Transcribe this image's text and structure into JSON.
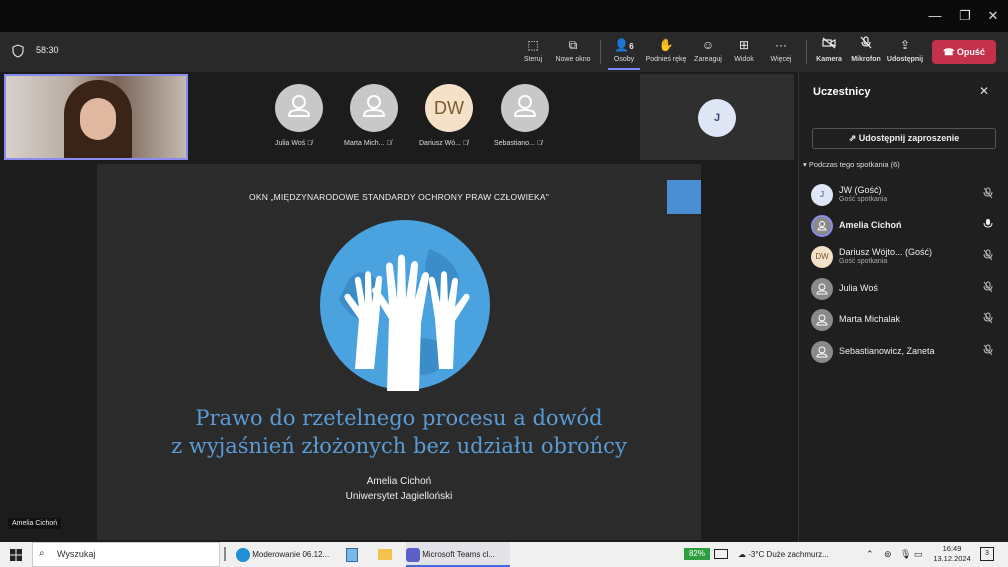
{
  "window": {
    "minimize": "—",
    "maximize": "❐",
    "close": "✕"
  },
  "toolbar": {
    "timer": "58:30",
    "buttons": [
      {
        "label": "Steruj",
        "icon": "control-icon"
      },
      {
        "label": "Nowe okno",
        "icon": "new-window-icon"
      },
      {
        "label": "Osoby",
        "icon": "people-icon",
        "count": "6"
      },
      {
        "label": "Podnieś rękę",
        "icon": "raise-hand-icon"
      },
      {
        "label": "Zareaguj",
        "icon": "react-icon"
      },
      {
        "label": "Widok",
        "icon": "view-icon"
      },
      {
        "label": "Więcej",
        "icon": "more-icon"
      },
      {
        "label": "Kamera",
        "icon": "camera-off-icon"
      },
      {
        "label": "Mikrofon",
        "icon": "mic-off-icon"
      },
      {
        "label": "Udostępnij",
        "icon": "share-icon"
      }
    ],
    "leave": "Opuść"
  },
  "stage": {
    "self_view_name": "Amelia Cichoń",
    "tiles": [
      {
        "name": "Julia Woś",
        "initials": ""
      },
      {
        "name": "Marta Mich...",
        "initials": ""
      },
      {
        "name": "Dariusz Wó...",
        "initials": "DW"
      },
      {
        "name": "Sebastiano...",
        "initials": ""
      }
    ],
    "right_tile_initial": "J",
    "presenter_label": "Amelia Cichoń"
  },
  "slide": {
    "header": "OKN „MIĘDZYNARODOWE STANDARDY OCHRONY PRAW CZŁOWIEKA\"",
    "title_line1": "Prawo do rzetelnego procesu a dowód",
    "title_line2": "z wyjaśnień złożonych bez udziału obrońcy",
    "author": "Amelia Cichoń",
    "affiliation": "Uniwersytet Jagielloński"
  },
  "panel": {
    "title": "Uczestnicy",
    "invite": "Udostępnij zaproszenie",
    "section": "Podczas tego spotkania (6)",
    "participants": [
      {
        "initials": "J",
        "name": "JW (Gość)",
        "sub": "Gość spotkania",
        "mic": "muted"
      },
      {
        "initials": "",
        "name": "Amelia Cichoń",
        "sub": "",
        "mic": "on"
      },
      {
        "initials": "DW",
        "name": "Dariusz Wójto...   (Gość)",
        "sub": "Gość spotkania",
        "mic": "muted"
      },
      {
        "initials": "",
        "name": "Julia Woś",
        "sub": "",
        "mic": "muted"
      },
      {
        "initials": "",
        "name": "Marta Michalak",
        "sub": "",
        "mic": "muted"
      },
      {
        "initials": "",
        "name": "Sebastianowicz, Zaneta",
        "sub": "",
        "mic": "muted"
      }
    ]
  },
  "taskbar": {
    "search_placeholder": "Wyszukaj",
    "apps": [
      {
        "label": "Moderowanie 06.12...",
        "icon": "edge-icon"
      },
      {
        "label": "",
        "icon": "notepad-icon"
      },
      {
        "label": "",
        "icon": "file-explorer-icon"
      },
      {
        "label": "Microsoft Teams cl...",
        "icon": "teams-icon"
      }
    ],
    "battery": "82%",
    "weather": "-3°C  Duże zachmurz...",
    "time": "16:49",
    "date": "13.12.2024",
    "notifications": "3"
  },
  "colors": {
    "accent": "#6264a7",
    "leave": "#c4314b",
    "slide_title": "#5b9bd5",
    "globe": "#4aa3df"
  }
}
